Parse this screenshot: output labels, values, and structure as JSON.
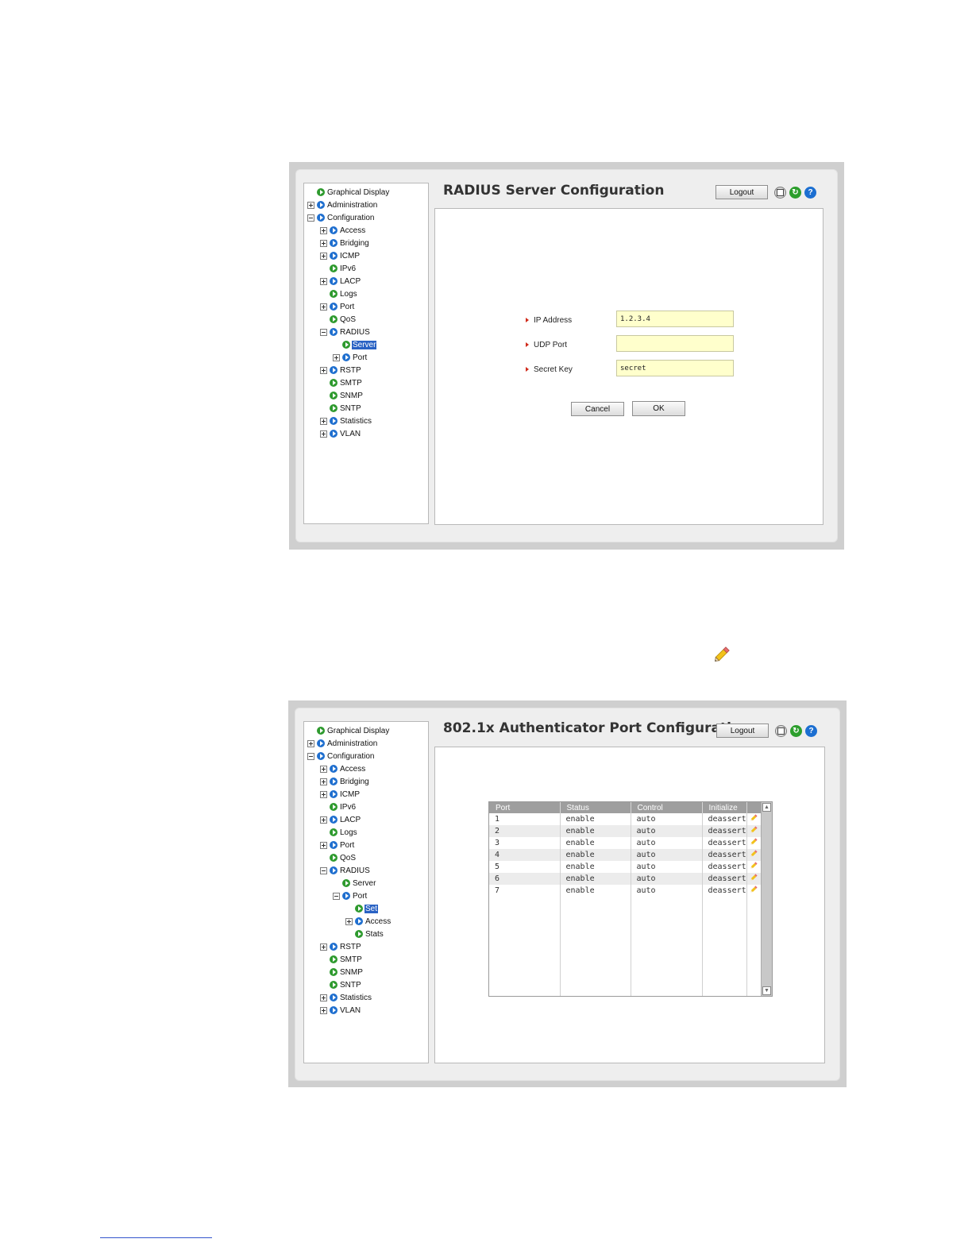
{
  "nav_tree": {
    "items": [
      {
        "label": "Graphical Display"
      },
      {
        "label": "Administration"
      },
      {
        "label": "Configuration"
      },
      {
        "label": "Access"
      },
      {
        "label": "Bridging"
      },
      {
        "label": "ICMP"
      },
      {
        "label": "IPv6"
      },
      {
        "label": "LACP"
      },
      {
        "label": "Logs"
      },
      {
        "label": "Port"
      },
      {
        "label": "QoS"
      },
      {
        "label": "RADIUS"
      },
      {
        "label": "Server"
      },
      {
        "label": "Port"
      },
      {
        "label": "Set"
      },
      {
        "label": "Access"
      },
      {
        "label": "Stats"
      },
      {
        "label": "RSTP"
      },
      {
        "label": "SMTP"
      },
      {
        "label": "SNMP"
      },
      {
        "label": "SNTP"
      },
      {
        "label": "Statistics"
      },
      {
        "label": "VLAN"
      }
    ]
  },
  "toolbar": {
    "logout_label": "Logout",
    "save_icon": "save-icon",
    "refresh_icon": "refresh-icon",
    "help_icon": "help-icon",
    "help_glyph": "?",
    "refresh_glyph": "↻"
  },
  "radius_panel": {
    "title": "RADIUS Server Configuration",
    "fields": {
      "ip_address": {
        "label": "IP Address",
        "value": "1.2.3.4"
      },
      "udp_port": {
        "label": "UDP Port",
        "value": ""
      },
      "secret_key": {
        "label": "Secret Key",
        "value": "secret"
      }
    },
    "cancel_label": "Cancel",
    "ok_label": "OK"
  },
  "port_panel": {
    "title": "802.1x Authenticator Port Configuration",
    "columns": [
      "Port",
      "Status",
      "Control",
      "Initialize"
    ],
    "rows": [
      {
        "port": "1",
        "status": "enable",
        "control": "auto",
        "initialize": "deassert"
      },
      {
        "port": "2",
        "status": "enable",
        "control": "auto",
        "initialize": "deassert"
      },
      {
        "port": "3",
        "status": "enable",
        "control": "auto",
        "initialize": "deassert"
      },
      {
        "port": "4",
        "status": "enable",
        "control": "auto",
        "initialize": "deassert"
      },
      {
        "port": "5",
        "status": "enable",
        "control": "auto",
        "initialize": "deassert"
      },
      {
        "port": "6",
        "status": "enable",
        "control": "auto",
        "initialize": "deassert"
      },
      {
        "port": "7",
        "status": "enable",
        "control": "auto",
        "initialize": "deassert"
      }
    ],
    "row_edit_icon": "pencil-icon",
    "scroll_up_glyph": "▲",
    "scroll_down_glyph": "▼"
  },
  "colors": {
    "selected_node": "#2962c4",
    "input_background": "#ffffcc",
    "required_marker": "#d02b1b",
    "table_header": "#9e9e9e"
  }
}
